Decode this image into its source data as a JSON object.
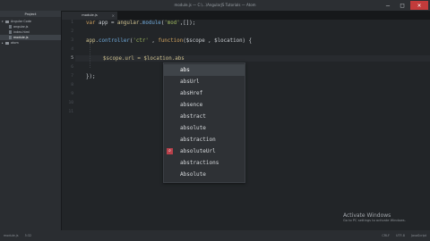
{
  "titlebar": {
    "title": "module.js — C:\\...\\AngularJS Tutorials — Atom",
    "minimize": "–",
    "maximize": "□",
    "close": "✕"
  },
  "sidebar": {
    "header": "Project",
    "items": [
      {
        "label": "Angular Code",
        "kind": "folder",
        "depth": 0,
        "expanded": true,
        "selected": false
      },
      {
        "label": "angular.js",
        "kind": "file",
        "depth": 1,
        "selected": false
      },
      {
        "label": "index.html",
        "kind": "file",
        "depth": 1,
        "selected": false
      },
      {
        "label": "module.js",
        "kind": "file",
        "depth": 1,
        "selected": true
      },
      {
        "label": "atom",
        "kind": "folder",
        "depth": 0,
        "expanded": false,
        "selected": false
      }
    ]
  },
  "tabs": [
    {
      "label": "module.js",
      "active": true
    }
  ],
  "editor": {
    "line_numbers": [
      "1",
      "2",
      "3",
      "4",
      "5",
      "6",
      "7",
      "8",
      "9",
      "10",
      "11"
    ],
    "current_line": 5,
    "lines": {
      "l1": {
        "kw": "var",
        "name": " app ",
        "rest": "= ",
        "obj": "angular",
        "dot": ".",
        "fn": "module",
        "open": "(",
        "str": "'mod'",
        "close": ",[]);"
      },
      "l3": {
        "obj": "app",
        "dot": ".",
        "fn": "controller",
        "open": "(",
        "str": "'ctr'",
        "mid": " , ",
        "kw": "function",
        "rest": "($scope , $location) {"
      },
      "l5": {
        "text": "$scope.url = $location.abs"
      },
      "l7": {
        "text": "});"
      }
    }
  },
  "autocomplete": {
    "items": [
      {
        "label": "abs",
        "selected": true,
        "icon": null
      },
      {
        "label": "absUrl",
        "selected": false,
        "icon": null
      },
      {
        "label": "absHref",
        "selected": false,
        "icon": null
      },
      {
        "label": "absence",
        "selected": false,
        "icon": null
      },
      {
        "label": "abstract",
        "selected": false,
        "icon": null
      },
      {
        "label": "absolute",
        "selected": false,
        "icon": null
      },
      {
        "label": "abstraction",
        "selected": false,
        "icon": null
      },
      {
        "label": "absoluteUrl",
        "selected": false,
        "icon": "property-icon"
      },
      {
        "label": "abstractions",
        "selected": false,
        "icon": null
      },
      {
        "label": "Absolute",
        "selected": false,
        "icon": null
      }
    ]
  },
  "statusbar": {
    "file": "module.js",
    "position": "5:32",
    "line_ending": "CRLF",
    "encoding": "UTF-8",
    "grammar": "JavaScript"
  },
  "activation": {
    "title": "Activate Windows",
    "subtitle": "Go to PC settings to activate Windows."
  },
  "colors": {
    "background": "#222528",
    "sidebar": "#2a2d31",
    "keyword": "#d2a35f",
    "string": "#9fb95f",
    "function": "#6fa8d8"
  }
}
